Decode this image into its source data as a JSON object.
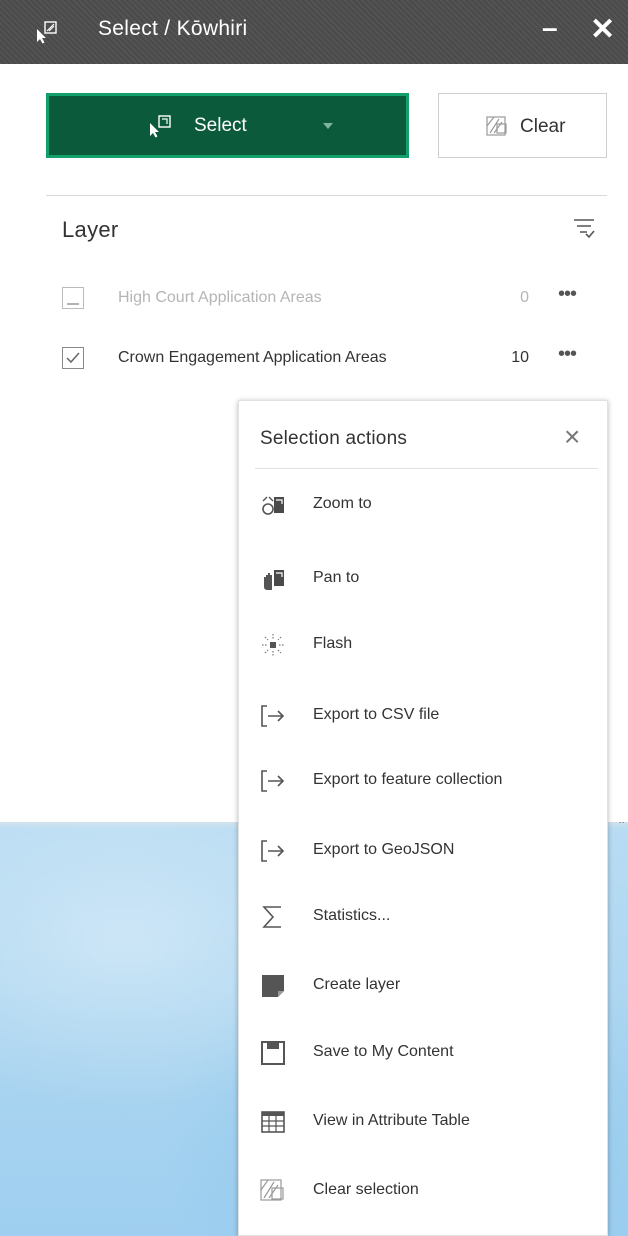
{
  "window": {
    "title": "Select / Kōwhiri",
    "minimize": "–",
    "close": "✕",
    "titlebar_color": "#4a4a4a"
  },
  "toolbar": {
    "select_label": "Select",
    "clear_label": "Clear",
    "select_color": "#0b5a3b",
    "select_border": "#14a06a"
  },
  "layers": {
    "heading": "Layer",
    "items": [
      {
        "label": "High Court Application Areas",
        "count": "0",
        "checked": false,
        "enabled": false,
        "more": "•••"
      },
      {
        "label": "Crown Engagement Application Areas",
        "count": "10",
        "checked": true,
        "enabled": true,
        "more": "•••"
      }
    ]
  },
  "selection_actions": {
    "title": "Selection actions",
    "close": "×",
    "items": [
      {
        "label": "Zoom to",
        "icon": "zoom-to-icon"
      },
      {
        "label": "Pan to",
        "icon": "pan-to-icon"
      },
      {
        "label": "Flash",
        "icon": "flash-icon"
      },
      {
        "label": "Export to CSV file",
        "icon": "export-icon"
      },
      {
        "label": "Export to feature collection",
        "icon": "export-icon"
      },
      {
        "label": "Export to GeoJSON",
        "icon": "export-icon"
      },
      {
        "label": "Statistics...",
        "icon": "sigma-icon"
      },
      {
        "label": "Create layer",
        "icon": "create-layer-icon"
      },
      {
        "label": "Save to My Content",
        "icon": "save-icon"
      },
      {
        "label": "View in Attribute Table",
        "icon": "table-icon"
      },
      {
        "label": "Clear selection",
        "icon": "clear-selection-icon"
      }
    ]
  }
}
